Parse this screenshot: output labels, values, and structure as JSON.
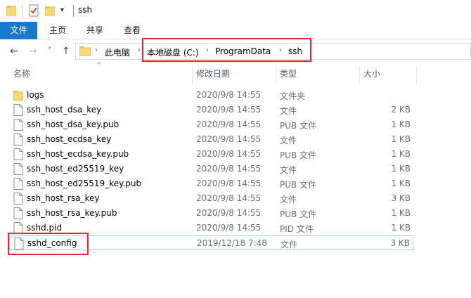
{
  "window": {
    "title": "ssh",
    "quick_access_dropdown": "▾"
  },
  "ribbon": {
    "tabs": [
      {
        "label": "文件"
      },
      {
        "label": "主页"
      },
      {
        "label": "共享"
      },
      {
        "label": "查看"
      }
    ]
  },
  "nav": {
    "back": "←",
    "forward": "→",
    "recent": "˅",
    "up": "↑"
  },
  "address": {
    "crumbs": [
      "此电脑",
      "本地磁盘 (C:)",
      "ProgramData",
      "ssh"
    ],
    "separator": "›"
  },
  "columns": {
    "name": "名称",
    "date": "修改日期",
    "type": "类型",
    "size": "大小",
    "sort_indicator": "^"
  },
  "files": [
    {
      "name": "logs",
      "date": "2020/9/8 14:55",
      "type": "文件夹",
      "size": "",
      "icon": "folder-icon"
    },
    {
      "name": "ssh_host_dsa_key",
      "date": "2020/9/8 14:55",
      "type": "文件",
      "size": "2 KB",
      "icon": "file-icon"
    },
    {
      "name": "ssh_host_dsa_key.pub",
      "date": "2020/9/8 14:55",
      "type": "PUB 文件",
      "size": "1 KB",
      "icon": "file-icon"
    },
    {
      "name": "ssh_host_ecdsa_key",
      "date": "2020/9/8 14:55",
      "type": "文件",
      "size": "1 KB",
      "icon": "file-icon"
    },
    {
      "name": "ssh_host_ecdsa_key.pub",
      "date": "2020/9/8 14:55",
      "type": "PUB 文件",
      "size": "1 KB",
      "icon": "file-icon"
    },
    {
      "name": "ssh_host_ed25519_key",
      "date": "2020/9/8 14:55",
      "type": "文件",
      "size": "1 KB",
      "icon": "file-icon"
    },
    {
      "name": "ssh_host_ed25519_key.pub",
      "date": "2020/9/8 14:55",
      "type": "PUB 文件",
      "size": "1 KB",
      "icon": "file-icon"
    },
    {
      "name": "ssh_host_rsa_key",
      "date": "2020/9/8 14:55",
      "type": "文件",
      "size": "3 KB",
      "icon": "file-icon"
    },
    {
      "name": "ssh_host_rsa_key.pub",
      "date": "2020/9/8 14:55",
      "type": "PUB 文件",
      "size": "1 KB",
      "icon": "file-icon"
    },
    {
      "name": "sshd.pid",
      "date": "2020/9/8 14:55",
      "type": "PID 文件",
      "size": "1 KB",
      "icon": "file-icon"
    },
    {
      "name": "sshd_config",
      "date": "2019/12/18 7:48",
      "type": "文件",
      "size": "3 KB",
      "icon": "file-icon",
      "selected": true
    }
  ],
  "colors": {
    "accent": "#1979ca",
    "highlight_box": "#e0282e",
    "folder": "#f8d775",
    "header_text": "#4c607a",
    "selection_border": "#99d1ff"
  }
}
